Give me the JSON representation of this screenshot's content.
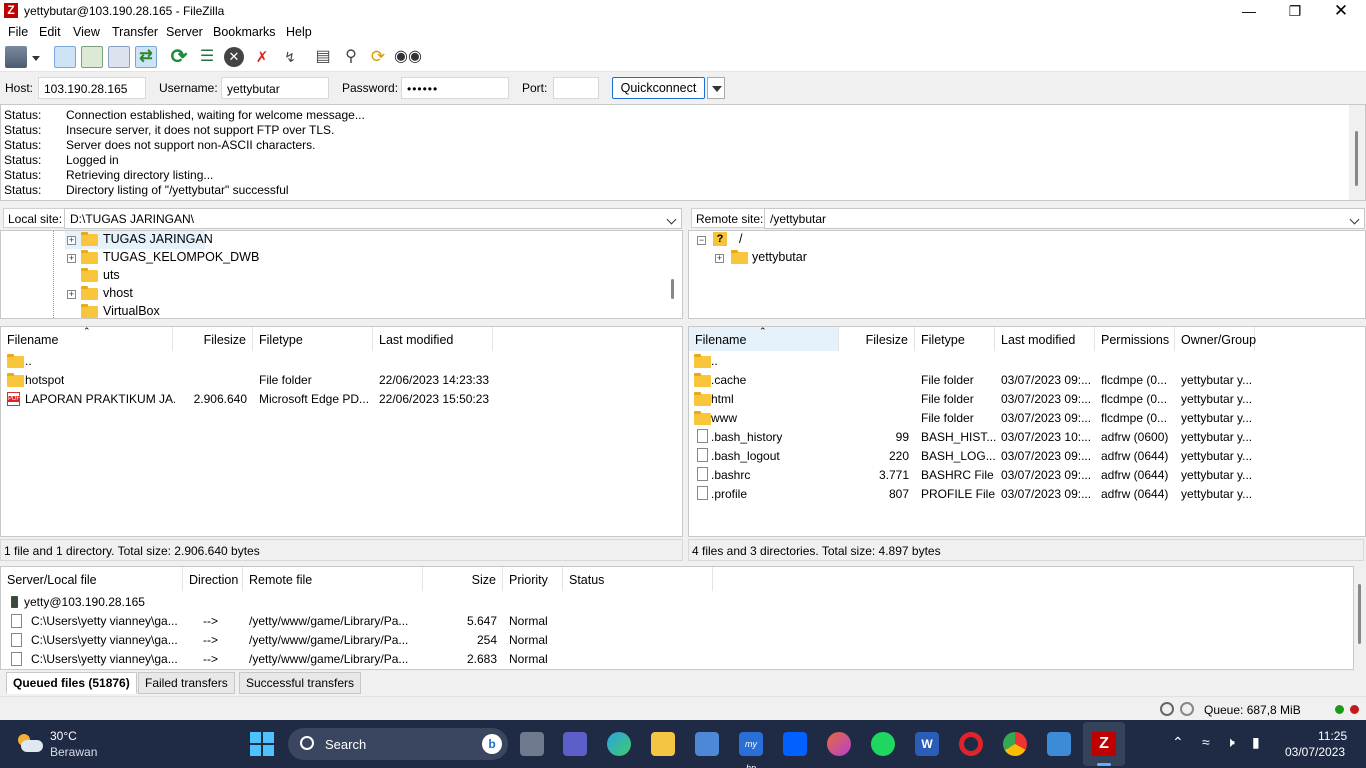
{
  "window": {
    "title": "yettybutar@103.190.28.165 - FileZilla",
    "app_icon": "Z"
  },
  "menu": [
    "File",
    "Edit",
    "View",
    "Transfer",
    "Server",
    "Bookmarks",
    "Help"
  ],
  "quickconnect": {
    "host_label": "Host:",
    "host_value": "103.190.28.165",
    "username_label": "Username:",
    "username_value": "yettybutar",
    "password_label": "Password:",
    "password_value": "••••••",
    "port_label": "Port:",
    "port_value": "",
    "button_label": "Quickconnect"
  },
  "log": [
    {
      "k": "Status:",
      "v": "Connection established, waiting for welcome message..."
    },
    {
      "k": "Status:",
      "v": "Insecure server, it does not support FTP over TLS."
    },
    {
      "k": "Status:",
      "v": "Server does not support non-ASCII characters."
    },
    {
      "k": "Status:",
      "v": "Logged in"
    },
    {
      "k": "Status:",
      "v": "Retrieving directory listing..."
    },
    {
      "k": "Status:",
      "v": "Directory listing of \"/yettybutar\" successful"
    }
  ],
  "local": {
    "site_label": "Local site:",
    "path": "D:\\TUGAS JARINGAN\\",
    "tree": [
      "TUGAS JARINGAN",
      "TUGAS_KELOMPOK_DWB",
      "uts",
      "vhost",
      "VirtualBox"
    ],
    "headers": [
      "Filename",
      "Filesize",
      "Filetype",
      "Last modified"
    ],
    "files": [
      {
        "name": "..",
        "size": "",
        "type": "",
        "modified": ""
      },
      {
        "name": "hotspot",
        "size": "",
        "type": "File folder",
        "modified": "22/06/2023 14:23:33"
      },
      {
        "name": "LAPORAN PRAKTIKUM JA...",
        "size": "2.906.640",
        "type": "Microsoft Edge PD...",
        "modified": "22/06/2023 15:50:23"
      }
    ],
    "summary": "1 file and 1 directory. Total size: 2.906.640 bytes"
  },
  "remote": {
    "site_label": "Remote site:",
    "path": "/yettybutar",
    "tree": [
      "/",
      "yettybutar"
    ],
    "headers": [
      "Filename",
      "Filesize",
      "Filetype",
      "Last modified",
      "Permissions",
      "Owner/Group"
    ],
    "files": [
      {
        "name": "..",
        "size": "",
        "type": "",
        "modified": "",
        "perm": "",
        "owner": ""
      },
      {
        "name": ".cache",
        "size": "",
        "type": "File folder",
        "modified": "03/07/2023 09:...",
        "perm": "flcdmpe (0...",
        "owner": "yettybutar y..."
      },
      {
        "name": "html",
        "size": "",
        "type": "File folder",
        "modified": "03/07/2023 09:...",
        "perm": "flcdmpe (0...",
        "owner": "yettybutar y..."
      },
      {
        "name": "www",
        "size": "",
        "type": "File folder",
        "modified": "03/07/2023 09:...",
        "perm": "flcdmpe (0...",
        "owner": "yettybutar y..."
      },
      {
        "name": ".bash_history",
        "size": "99",
        "type": "BASH_HIST...",
        "modified": "03/07/2023 10:...",
        "perm": "adfrw (0600)",
        "owner": "yettybutar y..."
      },
      {
        "name": ".bash_logout",
        "size": "220",
        "type": "BASH_LOG...",
        "modified": "03/07/2023 09:...",
        "perm": "adfrw (0644)",
        "owner": "yettybutar y..."
      },
      {
        "name": ".bashrc",
        "size": "3.771",
        "type": "BASHRC File",
        "modified": "03/07/2023 09:...",
        "perm": "adfrw (0644)",
        "owner": "yettybutar y..."
      },
      {
        "name": ".profile",
        "size": "807",
        "type": "PROFILE File",
        "modified": "03/07/2023 09:...",
        "perm": "adfrw (0644)",
        "owner": "yettybutar y..."
      }
    ],
    "summary": "4 files and 3 directories. Total size: 4.897 bytes"
  },
  "queue": {
    "headers": [
      "Server/Local file",
      "Direction",
      "Remote file",
      "Size",
      "Priority",
      "Status"
    ],
    "server": "yetty@103.190.28.165",
    "rows": [
      {
        "local": "C:\\Users\\yetty vianney\\ga...",
        "dir": "-->",
        "remote": "/yetty/www/game/Library/Pa...",
        "size": "5.647",
        "priority": "Normal"
      },
      {
        "local": "C:\\Users\\yetty vianney\\ga...",
        "dir": "-->",
        "remote": "/yetty/www/game/Library/Pa...",
        "size": "254",
        "priority": "Normal"
      },
      {
        "local": "C:\\Users\\yetty vianney\\ga...",
        "dir": "-->",
        "remote": "/yetty/www/game/Library/Pa...",
        "size": "2.683",
        "priority": "Normal"
      }
    ]
  },
  "tabs": [
    "Queued files (51876)",
    "Failed transfers",
    "Successful transfers"
  ],
  "statusbar": {
    "queue": "Queue: 687,8 MiB"
  },
  "taskbar": {
    "weather_temp": "30°C",
    "weather_desc": "Berawan",
    "search_label": "Search",
    "time": "11:25",
    "date": "03/07/2023"
  }
}
